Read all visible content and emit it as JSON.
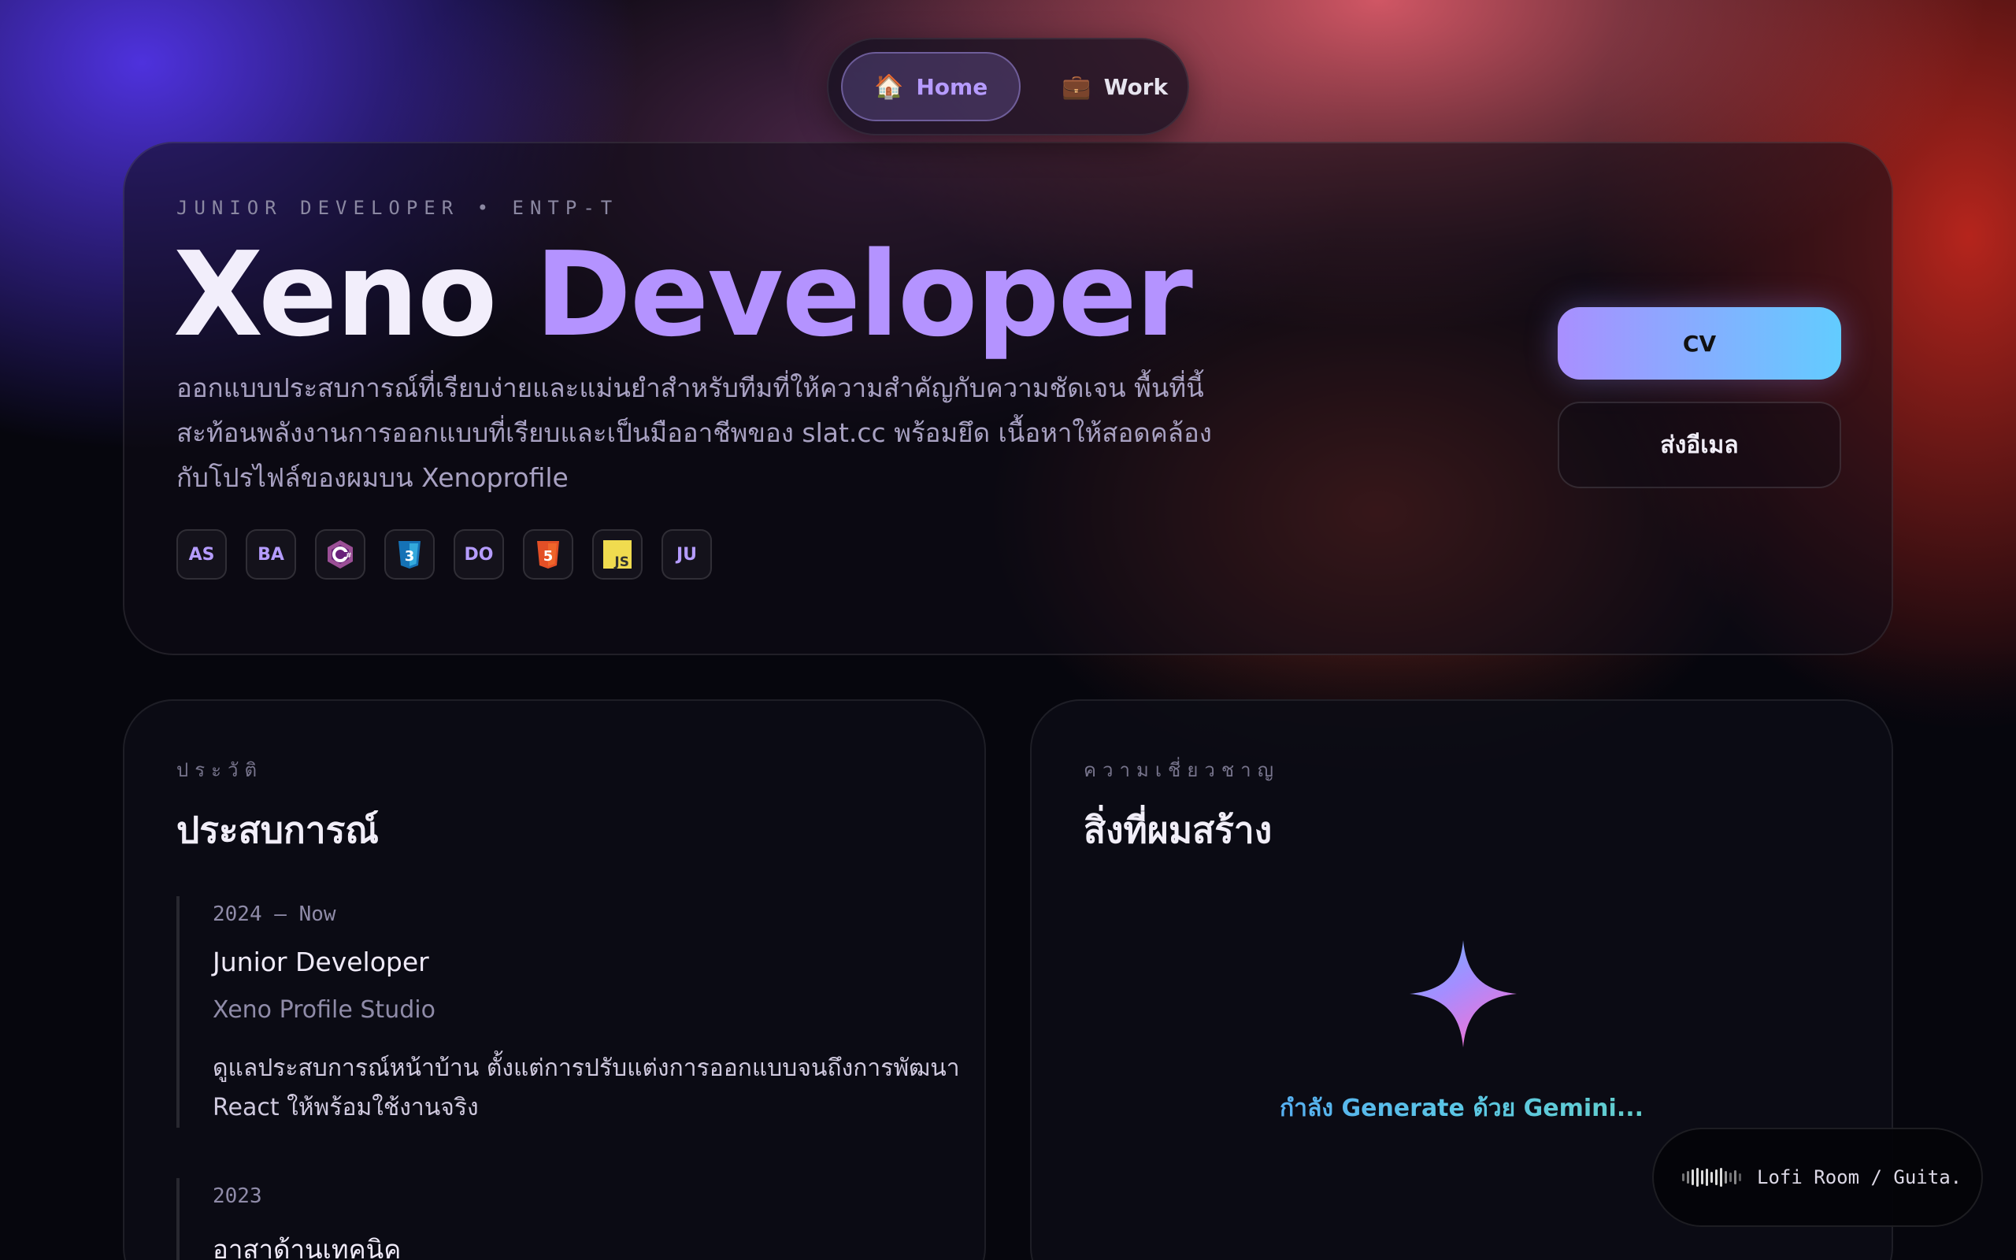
{
  "nav": {
    "items": [
      {
        "icon": "house-icon",
        "emoji": "🏠",
        "label": "Home",
        "active": true
      },
      {
        "icon": "briefcase-icon",
        "emoji": "💼",
        "label": "Work",
        "active": false
      }
    ]
  },
  "hero": {
    "eyebrow": "JUNIOR DEVELOPER • ENTP-T",
    "title_first": "Xeno",
    "title_second": "Developer",
    "description": "ออกแบบประสบการณ์ที่เรียบง่ายและแม่นยำสำหรับทีมที่ให้ความสำคัญกับความชัดเจน พื้นที่นี้สะท้อนพลังงานการออกแบบที่เรียบและเป็นมืออาชีพของ slat.cc พร้อมยึด เนื้อหาให้สอดคล้องกับโปรไฟล์ของผมบน Xenoprofile",
    "skills": [
      {
        "label": "AS",
        "icon": "as-badge-icon"
      },
      {
        "label": "BA",
        "icon": "ba-badge-icon"
      },
      {
        "label": "",
        "icon": "csharp-icon"
      },
      {
        "label": "",
        "icon": "css3-icon"
      },
      {
        "label": "DO",
        "icon": "do-badge-icon"
      },
      {
        "label": "",
        "icon": "html5-icon"
      },
      {
        "label": "JS",
        "icon": "javascript-icon"
      },
      {
        "label": "JU",
        "icon": "ju-badge-icon"
      }
    ],
    "cv_label": "CV",
    "email_label": "ส่งอีเมล"
  },
  "experience": {
    "eyebrow": "ประวัติ",
    "title": "ประสบการณ์",
    "items": [
      {
        "date": "2024 — Now",
        "role": "Junior Developer",
        "company": "Xeno Profile Studio",
        "text": "ดูแลประสบการณ์หน้าบ้าน ตั้งแต่การปรับแต่งการออกแบบจนถึงการพัฒนา React ให้พร้อมใช้งานจริง"
      },
      {
        "date": "2023",
        "role": "อาสาด้านเทคนิค",
        "company": "",
        "text": ""
      }
    ]
  },
  "expertise": {
    "eyebrow": "ความเชี่ยวชาญ",
    "title": "สิ่งที่ผมสร้าง",
    "icon": "sparkle-icon",
    "loading_text": "กำลัง Generate ด้วย Gemini..."
  },
  "player": {
    "icon": "waveform-icon",
    "title": "Lofi Room / Guita..."
  },
  "colors": {
    "accent": "#b493ff",
    "cv_gradient_start": "#a98fff",
    "cv_gradient_end": "#62ccff",
    "gemini_start": "#4f8dff",
    "gemini_end": "#6cd5a8"
  }
}
